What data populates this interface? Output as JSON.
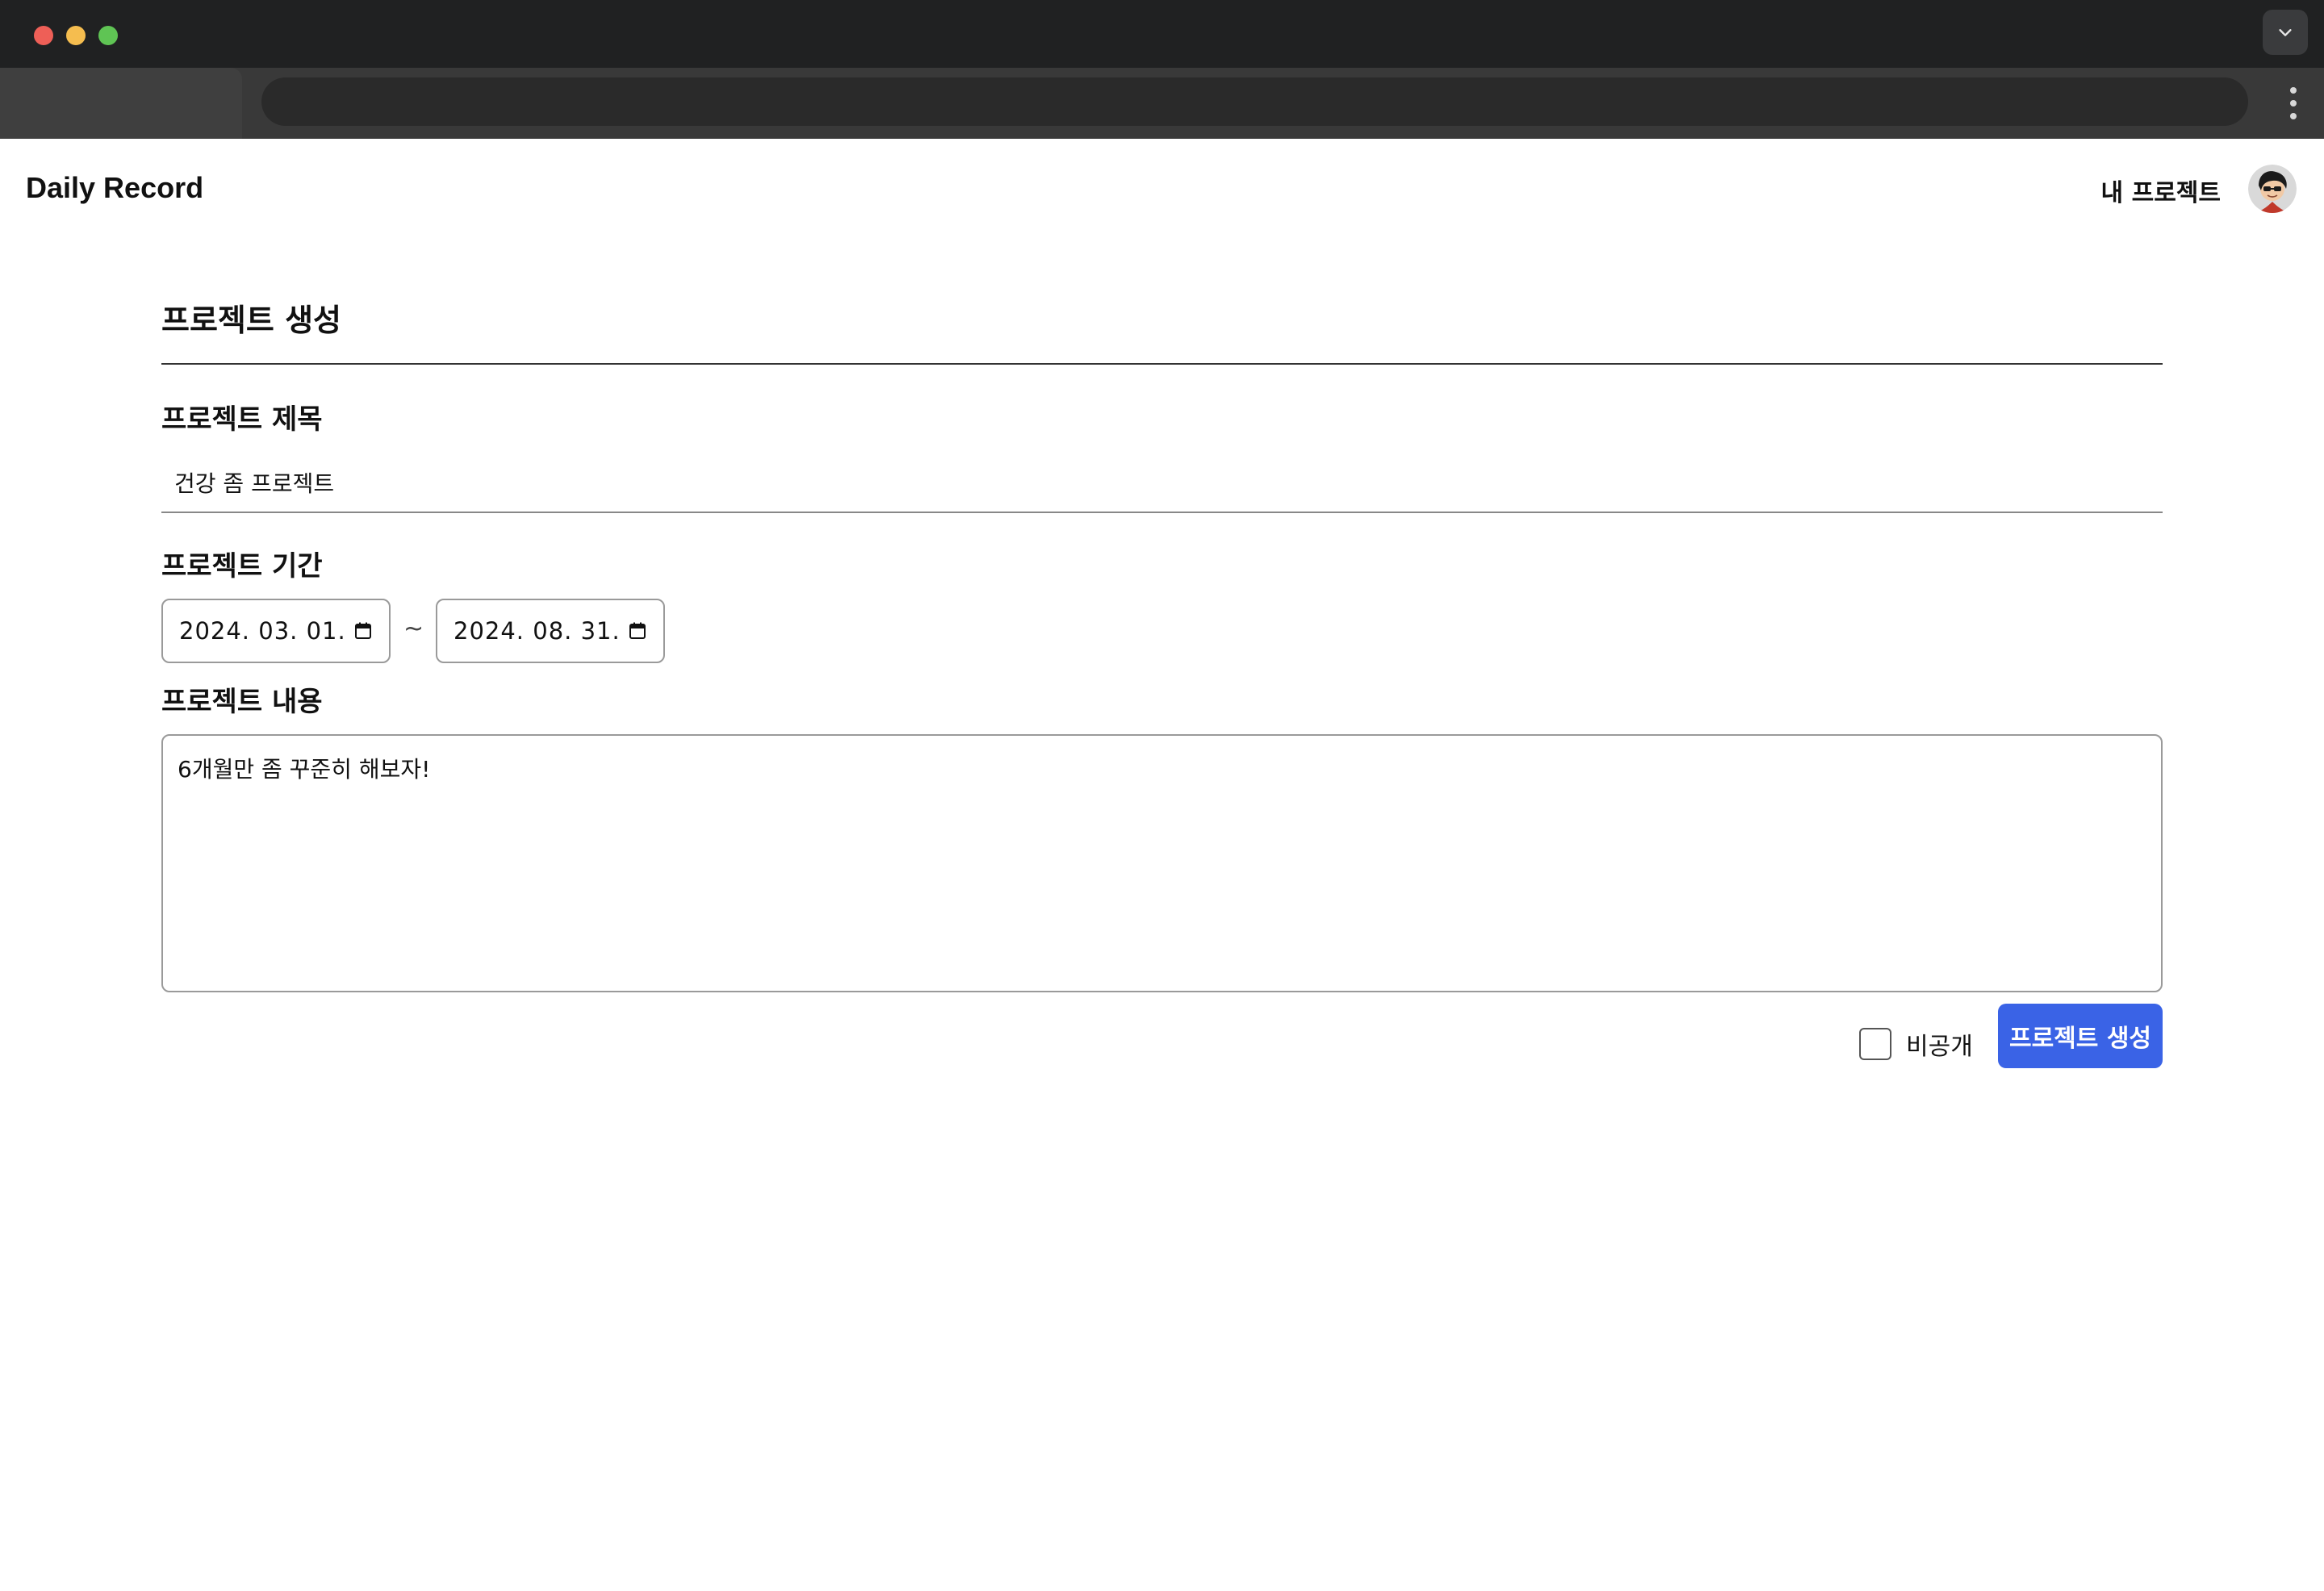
{
  "app": {
    "brand": "Daily Record",
    "nav_my_projects": "내 프로젝트",
    "avatar_icon": "user-avatar-icon"
  },
  "form": {
    "page_title": "프로젝트 생성",
    "title_label": "프로젝트 제목",
    "title_value": "건강 좀 프로젝트",
    "period_label": "프로젝트 기간",
    "start_date": "2024. 03. 01.",
    "range_separator": "~",
    "end_date": "2024. 08. 31.",
    "content_label": "프로젝트 내용",
    "content_value": "6개월만 좀 꾸준히 해보자!",
    "private_label": "비공개",
    "private_checked": false,
    "submit_label": "프로젝트 생성"
  },
  "colors": {
    "accent": "#3a63e6",
    "titlebar": "#202122",
    "toolbar": "#393939"
  }
}
